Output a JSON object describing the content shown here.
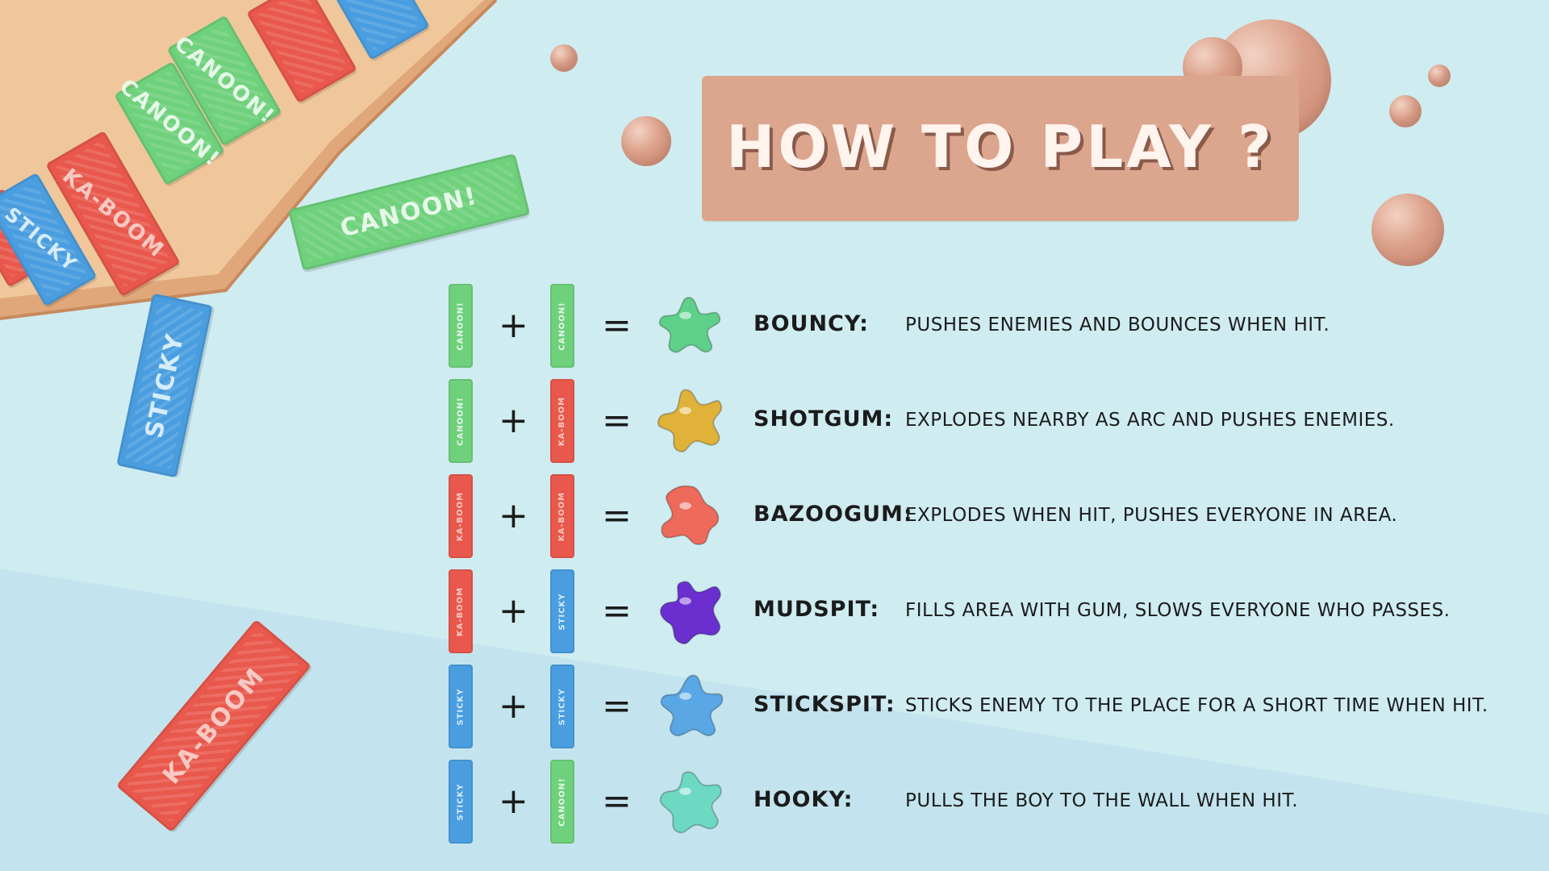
{
  "title": "HOW TO PLAY ?",
  "sticks": {
    "canoon": "CANOON!",
    "kaboom": "KA-BOOM",
    "sticky": "STICKY"
  },
  "decor_gums": {
    "canoon": "CANOON!",
    "sticky": "STICKY",
    "kaboom": "KA-BOOM"
  },
  "operators": {
    "plus": "+",
    "equals": "="
  },
  "colors": {
    "canoon": "#6fd17c",
    "kaboom": "#e9584c",
    "sticky": "#4a9ee0",
    "banner": "#dca58e",
    "background": "#cfecf1"
  },
  "rules": [
    {
      "left": "canoon",
      "right": "canoon",
      "splat_color": "#5fd08a",
      "name": "BOUNCY:",
      "description": "PUSHES ENEMIES AND BOUNCES WHEN HIT."
    },
    {
      "left": "canoon",
      "right": "kaboom",
      "splat_color": "#e0b23a",
      "name": "SHOTGUM:",
      "description": "EXPLODES NEARBY AS ARC AND PUSHES ENEMIES."
    },
    {
      "left": "kaboom",
      "right": "kaboom",
      "splat_color": "#ee6a5a",
      "name": "BAZOOGUM:",
      "description": "EXPLODES WHEN HIT, PUSHES EVERYONE IN AREA."
    },
    {
      "left": "kaboom",
      "right": "sticky",
      "splat_color": "#6b2fd0",
      "name": "MUDSPIT:",
      "description": "FILLS AREA WITH GUM, SLOWS EVERYONE WHO PASSES."
    },
    {
      "left": "sticky",
      "right": "sticky",
      "splat_color": "#5aa7e6",
      "name": "STICKSPIT:",
      "description": "STICKS ENEMY TO THE PLACE FOR A SHORT TIME WHEN HIT."
    },
    {
      "left": "sticky",
      "right": "canoon",
      "splat_color": "#6ed9c2",
      "name": "HOOKY:",
      "description": "PULLS THE BOY TO THE WALL WHEN HIT."
    }
  ]
}
